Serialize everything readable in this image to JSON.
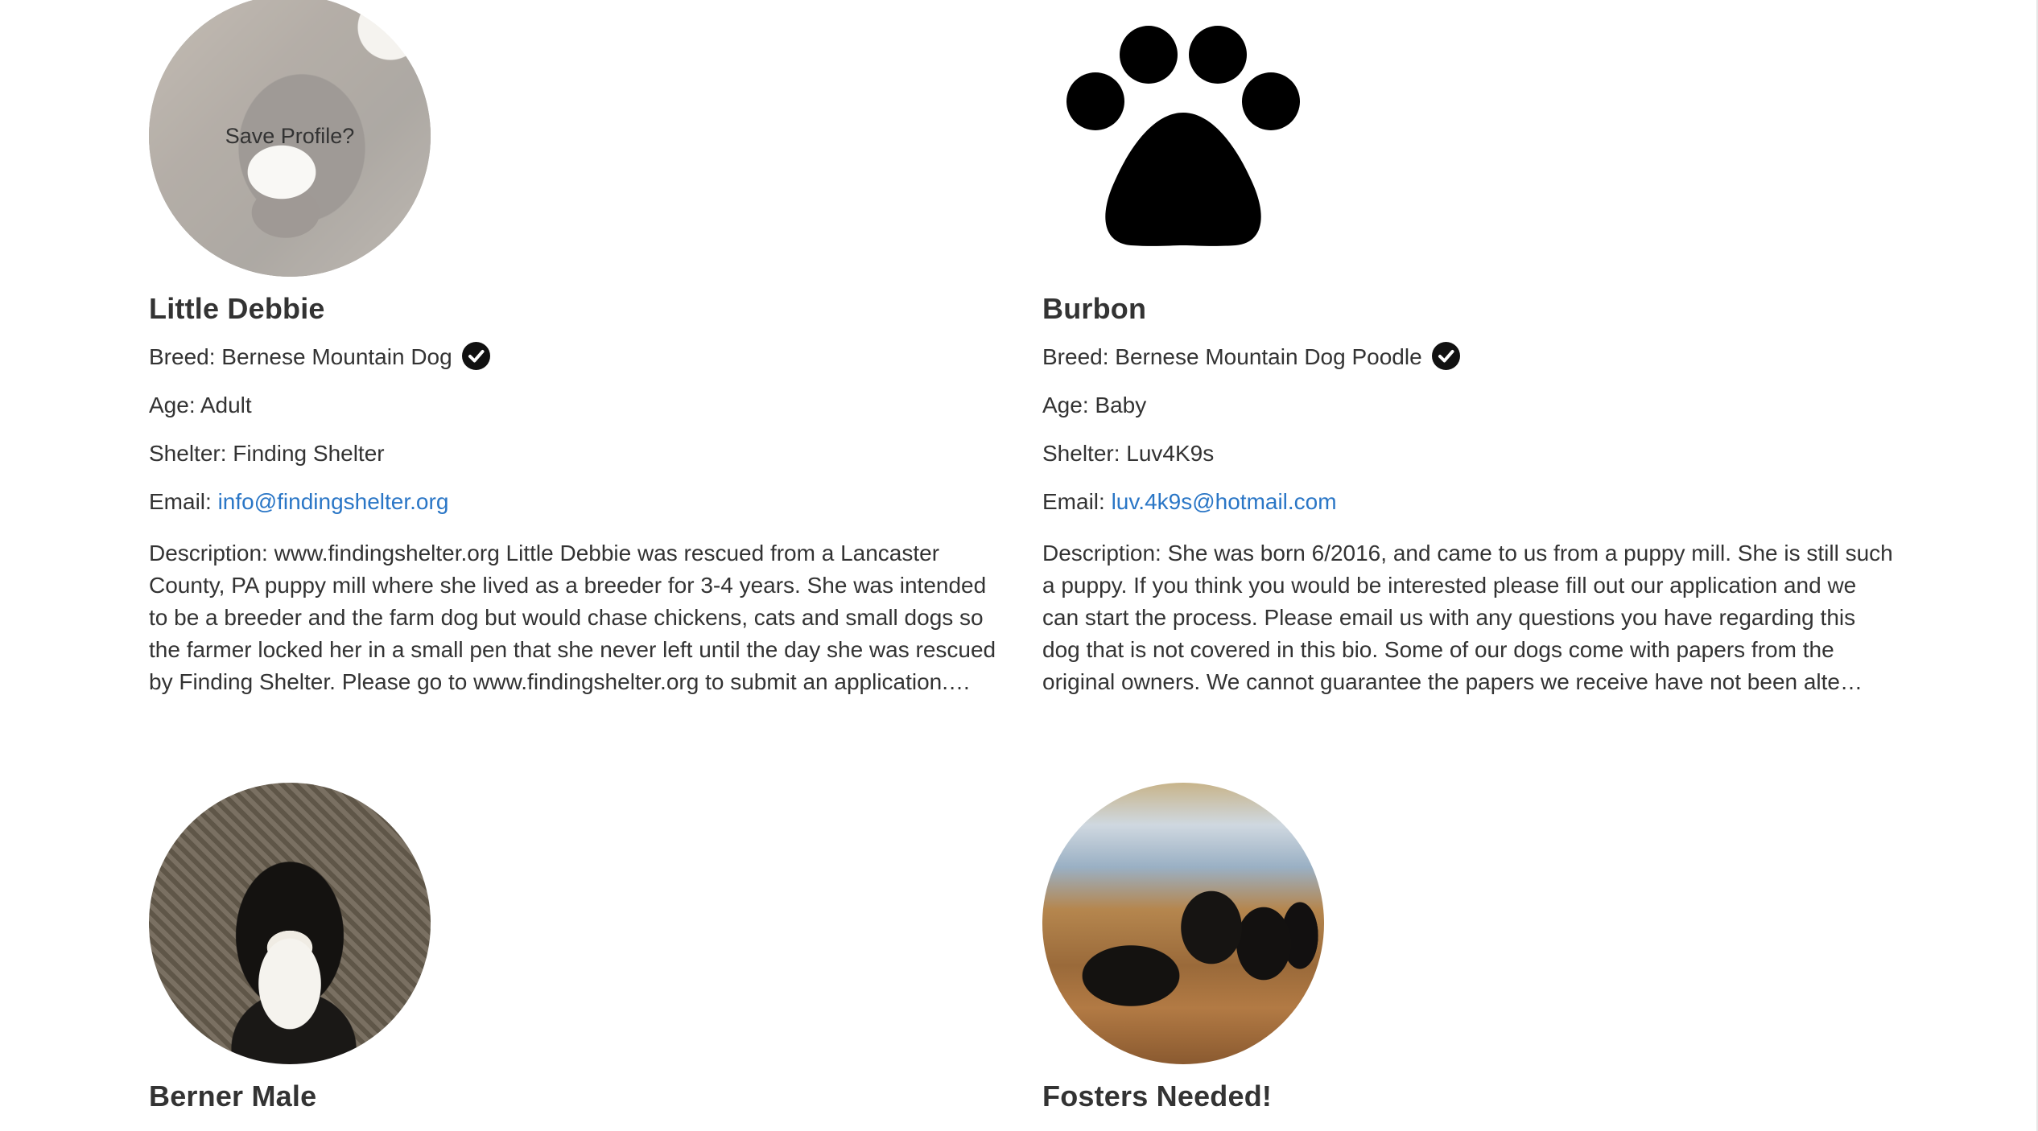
{
  "cards": [
    {
      "name": "Little Debbie",
      "overlay": "Save Profile?",
      "breed_label": "Breed:",
      "breed": "Bernese Mountain Dog",
      "age_label": "Age:",
      "age": "Adult",
      "shelter_label": "Shelter:",
      "shelter": "Finding Shelter",
      "email_label": "Email:",
      "email": "info@findingshelter.org",
      "description_label": "Description:",
      "description": "www.findingshelter.org Little Debbie was rescued from a Lancaster County, PA puppy mill where she lived as a breeder for 3-4 years. She was intended to be a breeder and the farm dog but would chase chickens, cats and small dogs so the farmer locked her in a small pen that she never left until the day she was rescued by Finding Shelter. Please go to www.findingshelter.org to submit an application.…",
      "image": "dog-photo"
    },
    {
      "name": "Burbon",
      "breed_label": "Breed:",
      "breed": "Bernese Mountain Dog Poodle",
      "age_label": "Age:",
      "age": "Baby",
      "shelter_label": "Shelter:",
      "shelter": "Luv4K9s",
      "email_label": "Email:",
      "email": "luv.4k9s@hotmail.com",
      "description_label": "Description:",
      "description": "She was born 6/2016, and came to us from a puppy mill. She is still such a puppy. If you think you would be interested please fill out our application and we can start the process. Please email us with any questions you have regarding this dog that is not covered in this bio. Some of our dogs come with papers from the original owners. We cannot guarantee the papers we receive have not been alte…",
      "image": "paw-icon"
    },
    {
      "name": "Berner Male",
      "image": "dog-photo"
    },
    {
      "name": "Fosters Needed!",
      "image": "dogs-group-photo"
    }
  ],
  "colors": {
    "text": "#333333",
    "link": "#2a76c6",
    "check": "#111111"
  }
}
